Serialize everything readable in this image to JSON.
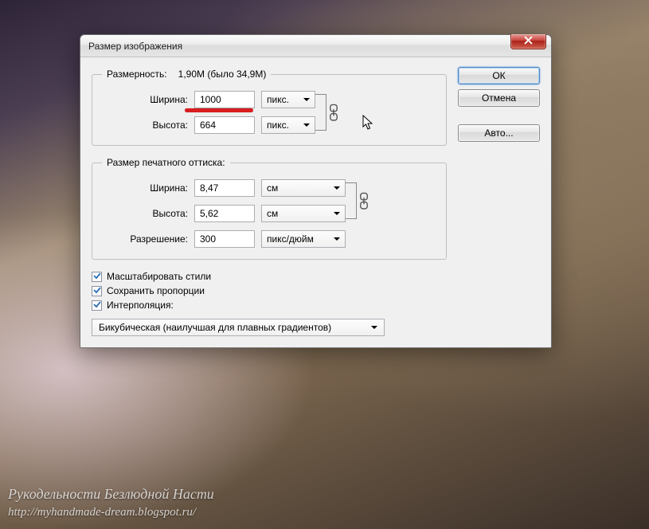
{
  "dialog": {
    "title": "Размер изображения",
    "pixel_section": {
      "legend_label": "Размерность:",
      "legend_stats": "1,90M (было 34,9M)",
      "width_label": "Ширина:",
      "width_value": "1000",
      "height_label": "Высота:",
      "height_value": "664",
      "unit": "пикс."
    },
    "print_section": {
      "legend": "Размер печатного оттиска:",
      "width_label": "Ширина:",
      "width_value": "8,47",
      "height_label": "Высота:",
      "height_value": "5,62",
      "unit": "см",
      "res_label": "Разрешение:",
      "res_value": "300",
      "res_unit": "пикс/дюйм"
    },
    "checks": {
      "scale_styles": "Масштабировать стили",
      "constrain": "Сохранить пропорции",
      "interp": "Интерполяция:"
    },
    "interp_method": "Бикубическая (наилучшая для плавных градиентов)",
    "buttons": {
      "ok": "ОК",
      "cancel": "Отмена",
      "auto": "Авто..."
    }
  },
  "watermark": {
    "line1": "Рукодельности Безлюдной Насти",
    "line2": "http://myhandmade-dream.blogspot.ru/"
  }
}
